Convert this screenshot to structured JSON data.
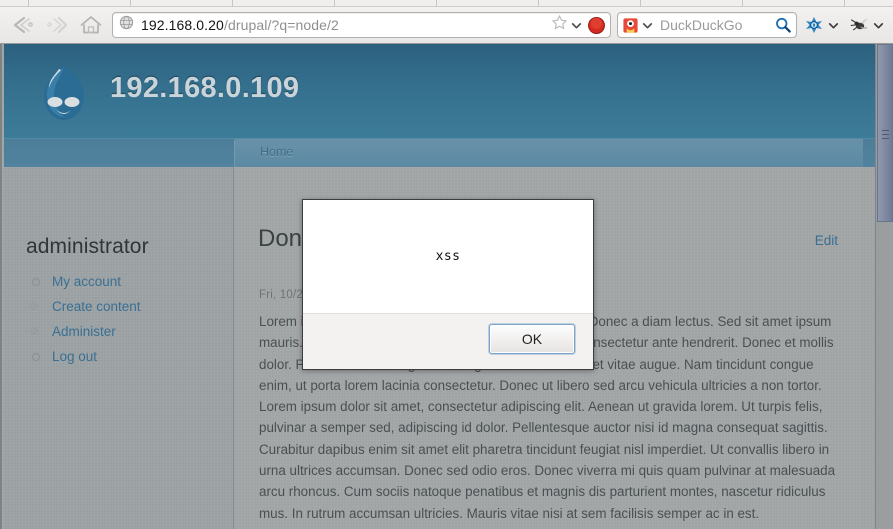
{
  "browser": {
    "back_label": "Back",
    "forward_label": "Forward",
    "home_label": "Home",
    "url_host": "192.168.0.20",
    "url_path": "/drupal/?q=node/2",
    "url_full": "192.168.0.20/drupal/?q=node/2",
    "bookmark_label": "Bookmark this page",
    "stop_label": "Stop",
    "search_engine": "DuckDuckGo",
    "search_placeholder": "DuckDuckGo",
    "search_value": "",
    "tool1_label": "Hackbar",
    "tool2_label": "Tamper Data",
    "colors": {
      "stop_red": "#d62a20",
      "accent_blue": "#1f6fb5",
      "chrome_bg": "#eeecea"
    }
  },
  "site": {
    "name": "192.168.0.109",
    "logo": "drupal-druplicon-logo",
    "breadcrumb": "Home",
    "colors": {
      "header_blue": "#35718f",
      "link_blue": "#3a6f92",
      "page_gray": "#a0a4a5"
    }
  },
  "sidebar": {
    "title": "administrator",
    "items": [
      {
        "label": "My account",
        "bullet": "circle"
      },
      {
        "label": "Create content",
        "bullet": "arrow"
      },
      {
        "label": "Administer",
        "bullet": "arrow"
      },
      {
        "label": "Log out",
        "bullet": "circle"
      }
    ]
  },
  "node": {
    "title": "Done",
    "tab_edit": "Edit",
    "submitted": "Fri, 10/2",
    "body": "Lorem ipsum dolor sit amet, consectetur adipiscing elit. Donec a diam lectus. Sed sit amet ipsum mauris. Maecenas congue ligula ac quam viverra nec consectetur ante hendrerit. Donec et mollis dolor. Praesent et diam eget libero egestas mattis sit amet vitae augue. Nam tincidunt congue enim, ut porta lorem lacinia consectetur. Donec ut libero sed arcu vehicula ultricies a non tortor. Lorem ipsum dolor sit amet, consectetur adipiscing elit. Aenean ut gravida lorem. Ut turpis felis, pulvinar a semper sed, adipiscing id dolor. Pellentesque auctor nisi id magna consequat sagittis. Curabitur dapibus enim sit amet elit pharetra tincidunt feugiat nisl imperdiet. Ut convallis libero in urna ultrices accumsan. Donec sed odio eros. Donec viverra mi quis quam pulvinar at malesuada arcu rhoncus. Cum sociis natoque penatibus et magnis dis parturient montes, nascetur ridiculus mus. In rutrum accumsan ultricies. Mauris vitae nisi at sem facilisis semper ac in est."
  },
  "alert": {
    "message": "xss",
    "ok_label": "OK"
  },
  "scrollbar": {
    "label": "vertical-scrollbar"
  }
}
